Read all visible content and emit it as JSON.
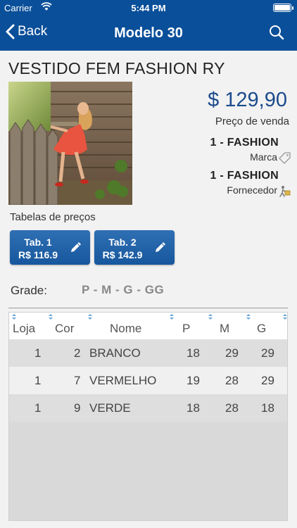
{
  "status_bar": {
    "carrier": "Carrier",
    "time": "5:44 PM"
  },
  "nav": {
    "back_label": "Back",
    "title": "Modelo 30"
  },
  "product": {
    "title": "VESTIDO FEM FASHION RY",
    "price": "$ 129,90",
    "price_label": "Preço de venda",
    "brand": "1 - FASHION",
    "brand_label": "Marca",
    "supplier": "1 - FASHION",
    "supplier_label": "Fornecedor"
  },
  "price_tables": {
    "label": "Tabelas de preços",
    "items": [
      {
        "name": "Tab. 1",
        "value": "R$ 116.9"
      },
      {
        "name": "Tab. 2",
        "value": "R$ 142.9"
      }
    ]
  },
  "grade": {
    "label": "Grade:",
    "value": "P - M - G - GG"
  },
  "grid": {
    "columns": [
      "Loja",
      "Cor",
      "Nome",
      "P",
      "M",
      "G"
    ],
    "rows": [
      {
        "loja": "1",
        "cor": "2",
        "nome": "BRANCO",
        "p": "18",
        "m": "29",
        "g": "29"
      },
      {
        "loja": "1",
        "cor": "7",
        "nome": "VERMELHO",
        "p": "19",
        "m": "28",
        "g": "29"
      },
      {
        "loja": "1",
        "cor": "9",
        "nome": "VERDE",
        "p": "18",
        "m": "28",
        "g": "18"
      }
    ]
  },
  "colors": {
    "nav_bg": "#0a4f99",
    "price": "#1a4b8c",
    "button": "#1e62a8",
    "row_alt": "#f0f0f0",
    "row": "#dedede"
  }
}
